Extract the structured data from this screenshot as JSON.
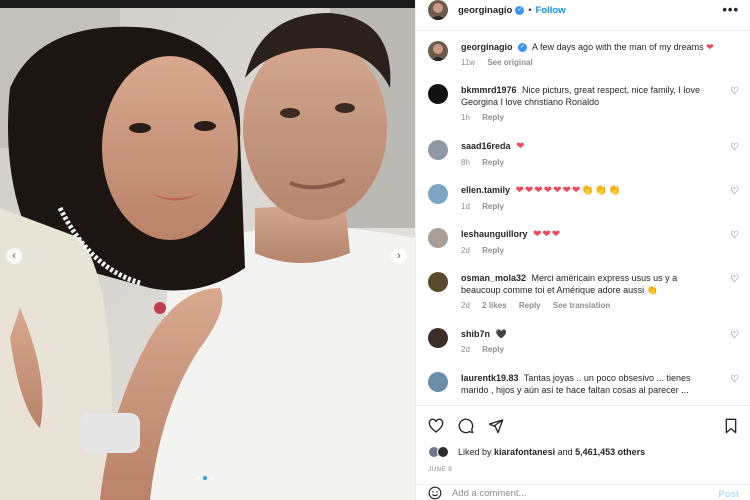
{
  "header": {
    "username": "georginagio",
    "separator": "•",
    "follow_label": "Follow",
    "more_label": "•••"
  },
  "caption": {
    "username": "georginagio",
    "text": "A few days ago with the man of my dreams",
    "emoji": "❤",
    "age": "11w",
    "see_original": "See original"
  },
  "comments": [
    {
      "username": "bkmmrd1976",
      "text": "Nice picturs, great respect, nice family, I love Georgina I love christiano Ronaldo",
      "age": "1h",
      "likes": "",
      "reply": "Reply",
      "translation": "",
      "avatar_color": "#111111"
    },
    {
      "username": "saad16reda",
      "text": "❤",
      "age": "8h",
      "likes": "",
      "reply": "Reply",
      "translation": "",
      "avatar_color": "#8f9aa5"
    },
    {
      "username": "ellen.tamily",
      "text": "❤❤❤❤❤❤❤👏👏👏",
      "age": "1d",
      "likes": "",
      "reply": "Reply",
      "translation": "",
      "avatar_color": "#7ea6c4"
    },
    {
      "username": "leshaunguillory",
      "text": "❤❤❤",
      "age": "2d",
      "likes": "",
      "reply": "Reply",
      "translation": "",
      "avatar_color": "#a89f96"
    },
    {
      "username": "osman_mola32",
      "text": "Merci américain express usus us y a beaucoup comme toi et Amérique adore aussi 👏",
      "age": "2d",
      "likes": "2 likes",
      "reply": "Reply",
      "translation": "See translation",
      "avatar_color": "#5a4a2d"
    },
    {
      "username": "shib7n",
      "text": "🖤",
      "age": "2d",
      "likes": "",
      "reply": "Reply",
      "translation": "",
      "avatar_color": "#3b2f2a"
    },
    {
      "username": "laurentk19.83",
      "text": "Tantas joyas .. un poco obsesivo ... tienes marido , hijos y aún así te hace faltan cosas al parecer ...",
      "age": "",
      "likes": "",
      "reply": "",
      "translation": "",
      "avatar_color": "#6b8fa8"
    }
  ],
  "actions": {
    "liked_by_prefix": "Liked by",
    "liked_by_user": "kiarafontanesi",
    "liked_by_and": "and",
    "liked_count": "5,461,453 others",
    "date": "JUNE 8"
  },
  "add_comment": {
    "placeholder": "Add a comment...",
    "post_label": "Post"
  },
  "colors": {
    "link_blue": "#0095f6",
    "verified_blue": "#3897f0",
    "heart_red": "#ed4956",
    "muted": "#8e8e8e"
  },
  "icons": [
    "verified-icon",
    "heart-icon",
    "comment-icon",
    "share-icon",
    "save-icon",
    "emoji-icon",
    "chevron-left-icon",
    "chevron-right-icon"
  ]
}
